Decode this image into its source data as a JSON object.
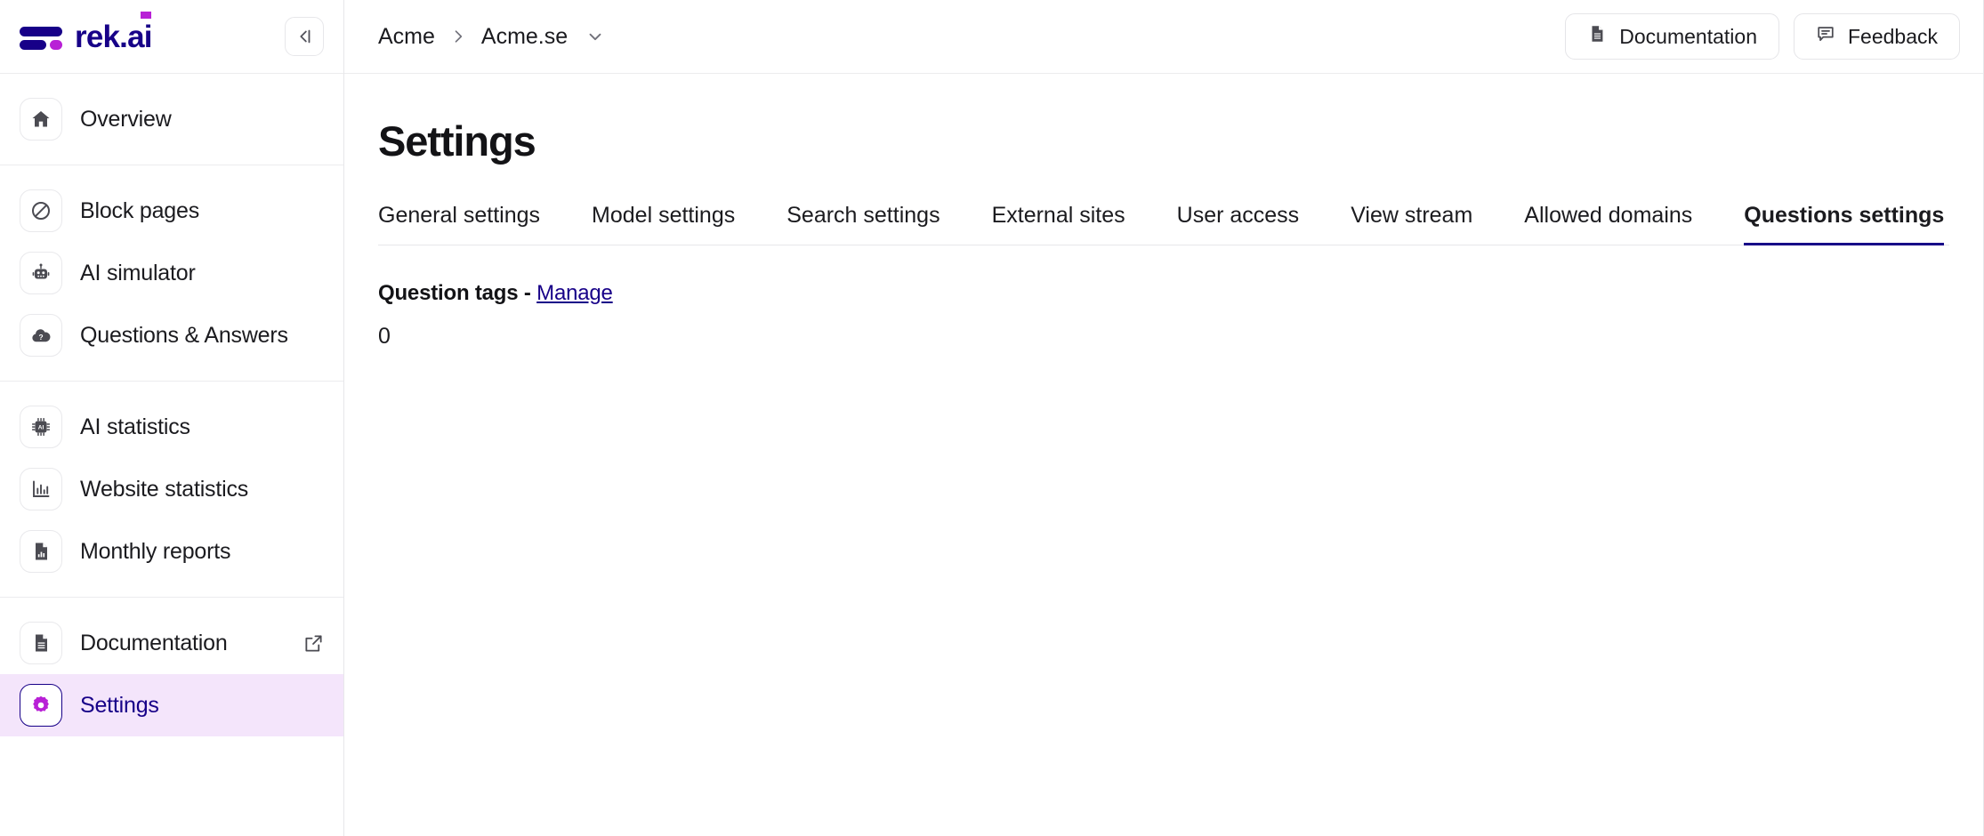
{
  "brand": {
    "name": "rek.ai",
    "logo_icon": "rek-ai-logo-icon",
    "collapse_icon": "collapse-sidebar-icon"
  },
  "sidebar": {
    "groups": [
      {
        "items": [
          {
            "label": "Overview",
            "icon": "home-icon",
            "active": false,
            "external": false
          }
        ]
      },
      {
        "items": [
          {
            "label": "Block pages",
            "icon": "block-icon",
            "active": false,
            "external": false
          },
          {
            "label": "AI simulator",
            "icon": "robot-icon",
            "active": false,
            "external": false
          },
          {
            "label": "Questions & Answers",
            "icon": "cloud-question-icon",
            "active": false,
            "external": false
          }
        ]
      },
      {
        "items": [
          {
            "label": "AI statistics",
            "icon": "chip-ai-icon",
            "active": false,
            "external": false
          },
          {
            "label": "Website statistics",
            "icon": "bar-chart-icon",
            "active": false,
            "external": false
          },
          {
            "label": "Monthly reports",
            "icon": "document-chart-icon",
            "active": false,
            "external": false
          }
        ]
      },
      {
        "items": [
          {
            "label": "Documentation",
            "icon": "document-icon",
            "active": false,
            "external": true
          },
          {
            "label": "Settings",
            "icon": "gear-icon",
            "active": true,
            "external": false
          }
        ]
      }
    ]
  },
  "topbar": {
    "breadcrumb": [
      {
        "label": "Acme"
      },
      {
        "label": "Acme.se"
      }
    ],
    "breadcrumb_separator_icon": "chevron-right-icon",
    "breadcrumb_caret_icon": "chevron-down-icon",
    "actions": [
      {
        "label": "Documentation",
        "icon": "document-icon"
      },
      {
        "label": "Feedback",
        "icon": "speech-bubble-icon"
      }
    ]
  },
  "page": {
    "title": "Settings",
    "tabs": [
      {
        "label": "General settings",
        "active": false
      },
      {
        "label": "Model settings",
        "active": false
      },
      {
        "label": "Search settings",
        "active": false
      },
      {
        "label": "External sites",
        "active": false
      },
      {
        "label": "User access",
        "active": false
      },
      {
        "label": "View stream",
        "active": false
      },
      {
        "label": "Allowed domains",
        "active": false
      },
      {
        "label": "Questions settings",
        "active": true
      }
    ],
    "question_tags": {
      "label": "Question tags",
      "separator": "-",
      "manage_link": "Manage",
      "count": "0"
    }
  },
  "colors": {
    "brand_indigo": "#170088",
    "brand_magenta": "#b820d6",
    "active_bg": "#f4e5fb",
    "border": "#e7e7ea",
    "text": "#1b1b1f"
  }
}
